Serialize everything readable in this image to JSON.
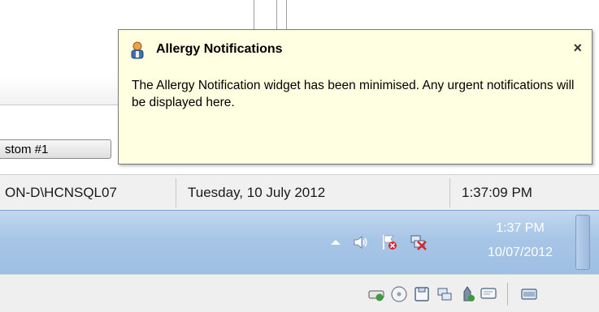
{
  "popup": {
    "title": "Allergy Notifications",
    "close_label": "×",
    "message": "The Allergy Notification widget has been minimised. Any urgent notifications will be displayed here."
  },
  "background": {
    "custom_button_label": "stom #1"
  },
  "status_bar": {
    "server": "ON-D\\HCNSQL07",
    "date": "Tuesday, 10 July 2012",
    "time": "1:37:09 PM"
  },
  "taskbar": {
    "clock_time": "1:37 PM",
    "clock_date": "10/07/2012",
    "tray_icons": [
      "show-hidden-icons",
      "volume-icon",
      "action-center-flag-icon",
      "network-disconnected-icon"
    ]
  },
  "bottom_bar": {
    "icons": [
      "hard-drive-icon",
      "optical-drive-icon",
      "floppy-icon",
      "network-icon",
      "usb-icon",
      "message-icon",
      "keyboard-icon"
    ]
  },
  "colors": {
    "popup_background": "#ffffe1",
    "taskbar_gradient_top": "#c2d8ef",
    "taskbar_gradient_bottom": "#9ebfe3",
    "status_bar_background": "#f0f0f0"
  }
}
